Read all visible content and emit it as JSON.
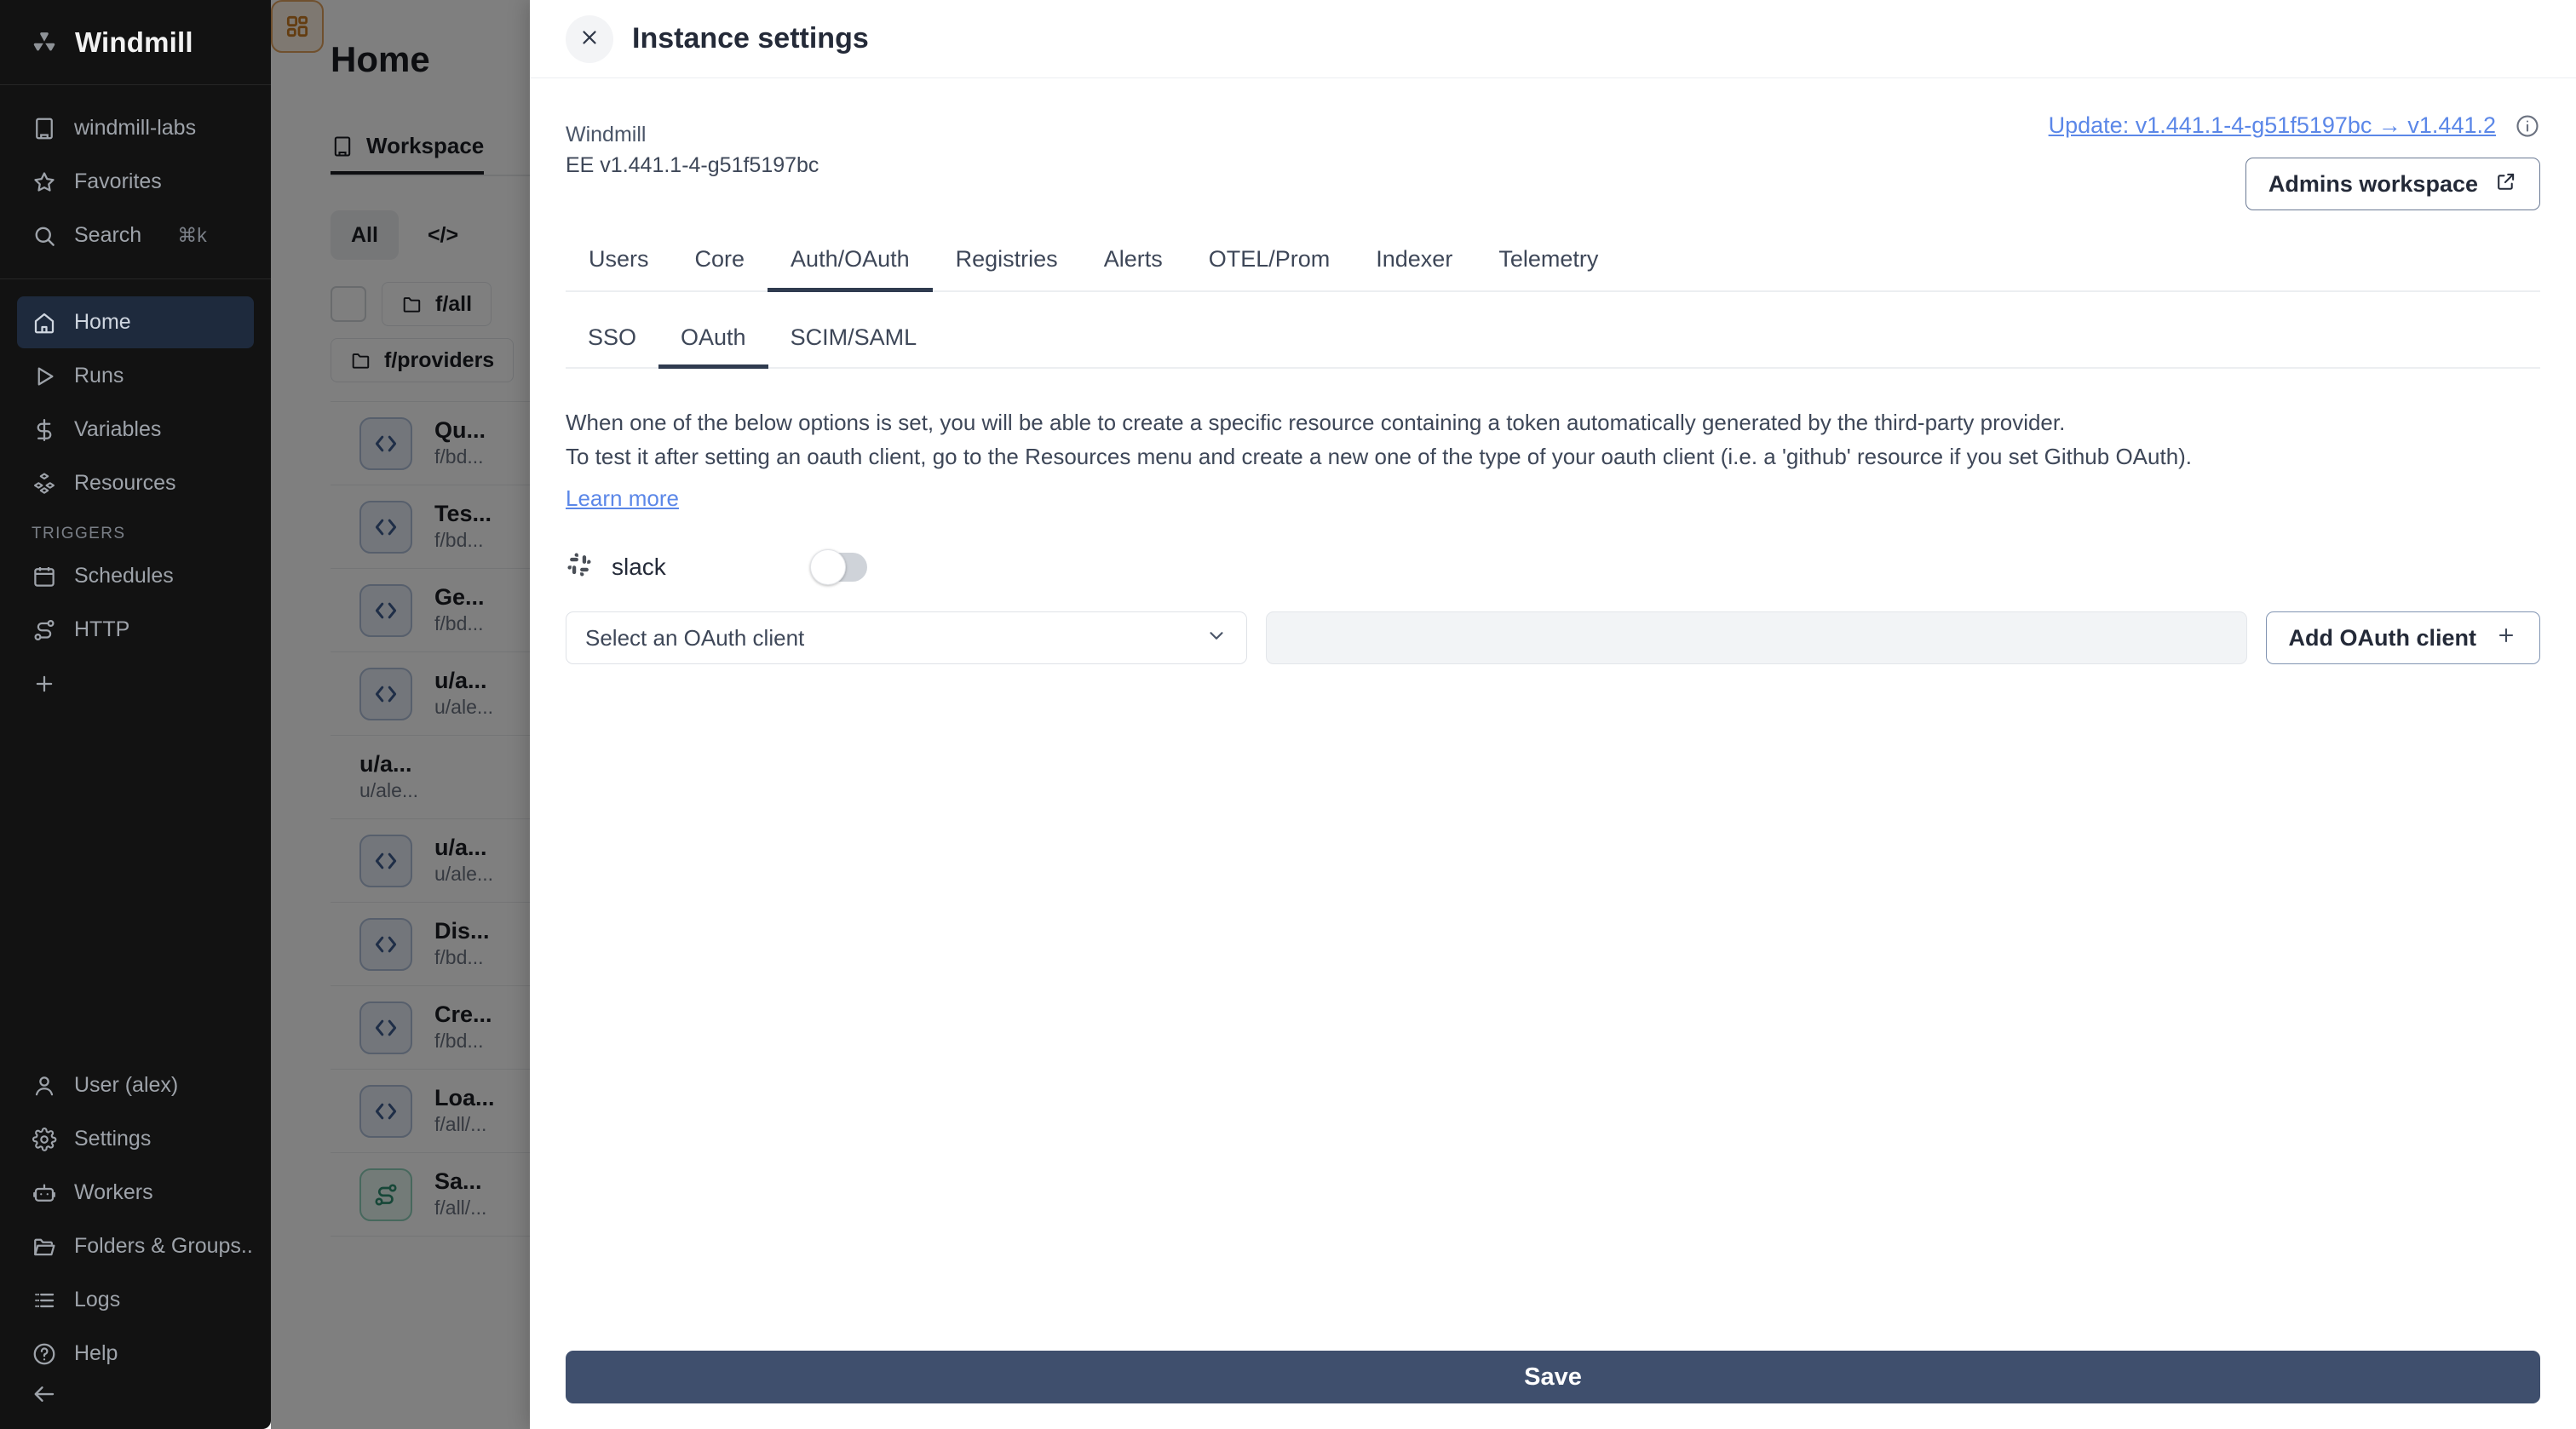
{
  "sidebar": {
    "brand": {
      "name": "Windmill",
      "logo_icon": "windmill-logo-icon"
    },
    "workspace": {
      "label": "windmill-labs",
      "icon": "building-icon"
    },
    "quick": [
      {
        "label": "Favorites",
        "icon": "star-icon"
      },
      {
        "label": "Search",
        "icon": "search-icon",
        "kbd": "⌘k"
      }
    ],
    "nav": [
      {
        "label": "Home",
        "icon": "home-icon",
        "active": true
      },
      {
        "label": "Runs",
        "icon": "play-icon",
        "active": false
      },
      {
        "label": "Variables",
        "icon": "dollar-icon",
        "active": false
      },
      {
        "label": "Resources",
        "icon": "cubes-icon",
        "active": false
      }
    ],
    "triggers_title": "TRIGGERS",
    "triggers": [
      {
        "label": "Schedules",
        "icon": "calendar-icon"
      },
      {
        "label": "HTTP",
        "icon": "route-icon"
      }
    ],
    "add_label": "+",
    "bottom": [
      {
        "label": "User (alex)",
        "icon": "user-icon"
      },
      {
        "label": "Settings",
        "icon": "gear-icon"
      },
      {
        "label": "Workers",
        "icon": "robot-icon"
      },
      {
        "label": "Folders & Groups...",
        "icon": "folder-icon"
      },
      {
        "label": "Logs",
        "icon": "list-icon"
      }
    ],
    "help": {
      "label": "Help",
      "icon": "help-circle-icon"
    },
    "collapse_icon": "arrow-left-icon"
  },
  "background": {
    "page_title": "Home",
    "workspace_tab": {
      "label": "Workspace",
      "icon": "building-icon"
    },
    "filters": [
      {
        "label": "All",
        "selected": true
      },
      {
        "label": "</>",
        "selected": false
      }
    ],
    "folders": [
      {
        "label": "f/all",
        "icon": "folder-icon"
      },
      {
        "label": "f/providers",
        "icon": "folder-icon"
      }
    ],
    "items": [
      {
        "name": "Qu...",
        "path": "f/bd...",
        "kind": "script"
      },
      {
        "name": "Tes...",
        "path": "f/bd...",
        "kind": "script"
      },
      {
        "name": "Ge...",
        "path": "f/bd...",
        "kind": "script"
      },
      {
        "name": "u/a...",
        "path": "u/ale...",
        "kind": "script"
      },
      {
        "name": "u/a...",
        "path": "u/ale...",
        "kind": "app"
      },
      {
        "name": "u/a...",
        "path": "u/ale...",
        "kind": "script"
      },
      {
        "name": "Dis...",
        "path": "f/bd...",
        "kind": "script"
      },
      {
        "name": "Cre...",
        "path": "f/bd...",
        "kind": "script"
      },
      {
        "name": "Loa...",
        "path": "f/all/...",
        "kind": "script"
      },
      {
        "name": "Sa...",
        "path": "f/all/...",
        "kind": "flow"
      }
    ]
  },
  "modal": {
    "title": "Instance settings",
    "close_icon": "close-icon",
    "product_name": "Windmill",
    "version_string": "EE v1.441.1-4-g51f5197bc",
    "update_text": "Update: v1.441.1-4-g51f5197bc → v1.441.2",
    "info_icon": "info-icon",
    "admins_workspace_label": "Admins workspace",
    "external_link_icon": "external-link-icon",
    "tabs": [
      {
        "label": "Users",
        "active": false
      },
      {
        "label": "Core",
        "active": false
      },
      {
        "label": "Auth/OAuth",
        "active": true
      },
      {
        "label": "Registries",
        "active": false
      },
      {
        "label": "Alerts",
        "active": false
      },
      {
        "label": "OTEL/Prom",
        "active": false
      },
      {
        "label": "Indexer",
        "active": false
      },
      {
        "label": "Telemetry",
        "active": false
      }
    ],
    "subtabs": [
      {
        "label": "SSO",
        "active": false
      },
      {
        "label": "OAuth",
        "active": true
      },
      {
        "label": "SCIM/SAML",
        "active": false
      }
    ],
    "description_line1": "When one of the below options is set, you will be able to create a specific resource containing a token automatically generated by the third-party provider.",
    "description_line2": "To test it after setting an oauth client, go to the Resources menu and create a new one of the type of your oauth client (i.e. a 'github' resource if you set Github OAuth).",
    "learn_more_label": "Learn more",
    "provider": {
      "name": "slack",
      "icon": "slack-icon",
      "enabled": false
    },
    "select_placeholder": "Select an OAuth client",
    "select_chevron_icon": "chevron-down-icon",
    "secret_input_value": "",
    "secret_input_placeholder": "",
    "add_oauth_client_label": "Add OAuth client",
    "plus_icon": "plus-icon",
    "save_label": "Save"
  },
  "colors": {
    "accent_link": "#5b87e8",
    "save_button": "#3f4f6d",
    "sidebar_bg": "#121212",
    "active_nav_bg": "#1e2a3d",
    "tab_underline": "#2f3b4f"
  }
}
